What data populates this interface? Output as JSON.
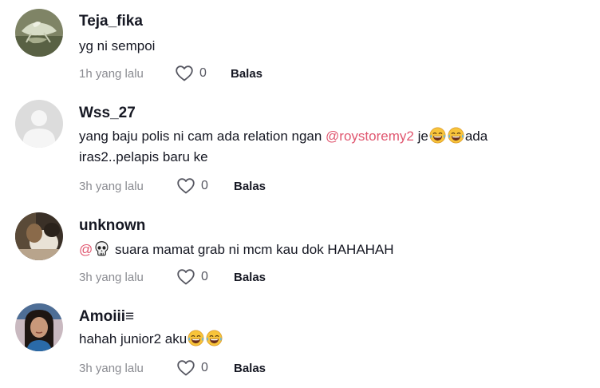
{
  "comments": [
    {
      "username": "Teja_fika",
      "text": "yg ni sempoi",
      "time": "1h yang lalu",
      "likes": "0",
      "reply_label": "Balas",
      "avatar_icon": "profile-photo-lizard"
    },
    {
      "username": "Wss_27",
      "text_before": "yang baju polis ni cam ada relation ngan ",
      "mention": "@roystoremy2",
      "text_after": " je",
      "text_after2": "ada",
      "text_line2": "iras2..pelapis baru ke",
      "time": "3h yang lalu",
      "likes": "0",
      "reply_label": "Balas",
      "avatar_icon": "default-avatar-icon"
    },
    {
      "username": "unknown",
      "mention": "@",
      "text": " suara mamat grab ni mcm kau dok HAHAHAH",
      "time": "3h yang lalu",
      "likes": "0",
      "reply_label": "Balas",
      "avatar_icon": "profile-photo-dark"
    },
    {
      "username": "Amoiii≡",
      "text": "hahah junior2 aku",
      "time": "3h yang lalu",
      "likes": "0",
      "reply_label": "Balas",
      "avatar_icon": "profile-photo-woman"
    }
  ],
  "icons": {
    "like": "heart-outline-icon",
    "laugh": "face-with-tears-of-joy-emoji",
    "skull": "skull-emoji"
  },
  "colors": {
    "mention": "#e0566f",
    "meta": "#8a8b91",
    "text": "#161823"
  }
}
